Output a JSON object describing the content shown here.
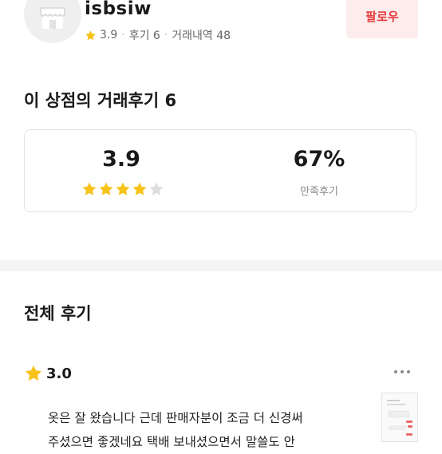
{
  "shop": {
    "name": "isbsiw",
    "rating": "3.9",
    "reviews_label": "후기 6",
    "trades_label": "거래내역 48",
    "follow_label": "팔로우",
    "avatar_icon": "storefront-icon"
  },
  "summary": {
    "title": "이 상점의 거래후기 6",
    "average": "3.9",
    "average_stars": 3.9,
    "satisfaction": "67%",
    "satisfaction_label": "만족후기"
  },
  "reviews": {
    "title": "전체 후기",
    "items": [
      {
        "rating": "3.0",
        "text_line1": "옷은 잘 왔습니다 근데 판매자분이 조금 더 신경써",
        "text_line2": "주셨으면 좋겠네요 택배 보내셨으면서 말쓸도 안"
      }
    ]
  },
  "colors": {
    "star": "#f7c31b",
    "star_empty": "#dddddd",
    "accent": "#e53b3b",
    "follow_bg": "#fdecec"
  }
}
